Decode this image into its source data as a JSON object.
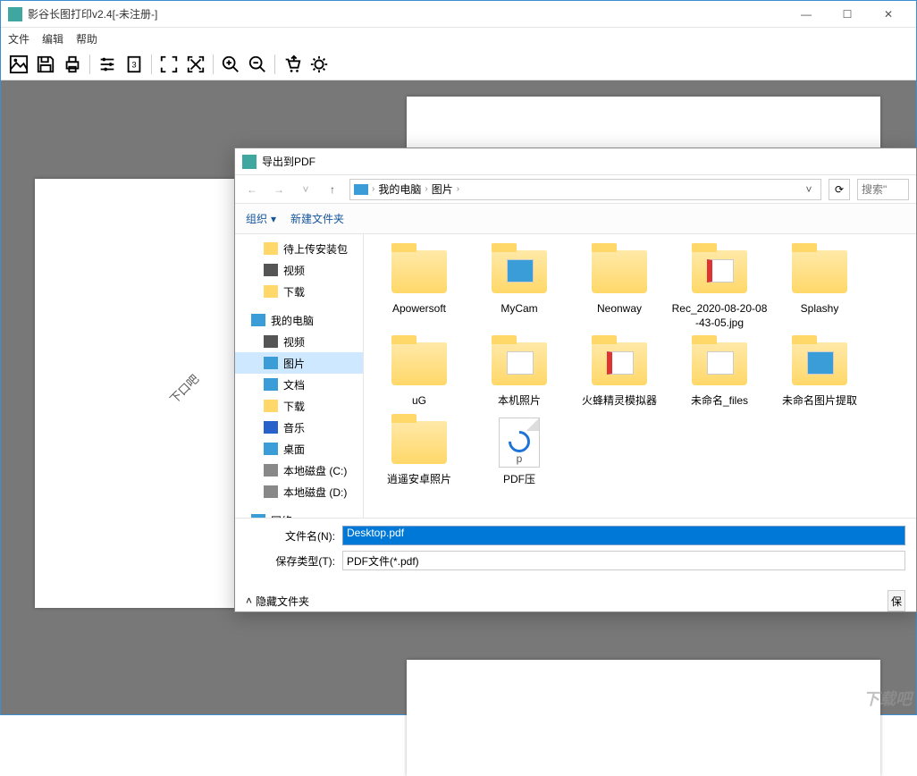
{
  "app": {
    "title": "影谷长图打印v2.4[-未注册-]",
    "menu": {
      "file": "文件",
      "edit": "编辑",
      "help": "帮助"
    },
    "rotated_hint": "下口吧"
  },
  "dialog": {
    "title": "导出到PDF",
    "breadcrumb": {
      "root": "我的电脑",
      "folder": "图片"
    },
    "search_placeholder": "搜索\"",
    "toolbar": {
      "organize": "组织",
      "new_folder": "新建文件夹"
    },
    "tree": [
      {
        "label": "待上传安装包",
        "icon": "ico-folder",
        "level": "l2"
      },
      {
        "label": "视频",
        "icon": "ico-video",
        "level": "l2"
      },
      {
        "label": "下载",
        "icon": "ico-download",
        "level": "l2"
      },
      {
        "label": "",
        "icon": "",
        "level": "spacer"
      },
      {
        "label": "我的电脑",
        "icon": "ico-computer",
        "level": ""
      },
      {
        "label": "视频",
        "icon": "ico-video",
        "level": "l2"
      },
      {
        "label": "图片",
        "icon": "ico-pictures",
        "level": "l2",
        "selected": true
      },
      {
        "label": "文档",
        "icon": "ico-doc",
        "level": "l2"
      },
      {
        "label": "下载",
        "icon": "ico-download",
        "level": "l2"
      },
      {
        "label": "音乐",
        "icon": "ico-music",
        "level": "l2"
      },
      {
        "label": "桌面",
        "icon": "ico-desktop",
        "level": "l2"
      },
      {
        "label": "本地磁盘 (C:)",
        "icon": "ico-disk",
        "level": "l2"
      },
      {
        "label": "本地磁盘 (D:)",
        "icon": "ico-disk",
        "level": "l2"
      },
      {
        "label": "",
        "icon": "",
        "level": "spacer"
      },
      {
        "label": "网络",
        "icon": "ico-network",
        "level": ""
      }
    ],
    "files": [
      {
        "name": "Apowersoft",
        "type": "folder"
      },
      {
        "name": "MyCam",
        "type": "folder-blue"
      },
      {
        "name": "Neonway",
        "type": "folder"
      },
      {
        "name": "Rec_2020-08-20-08-43-05.jpg",
        "type": "folder-red"
      },
      {
        "name": "Splashy",
        "type": "folder"
      },
      {
        "name": "uG",
        "type": "folder"
      },
      {
        "name": "本机照片",
        "type": "folder-page"
      },
      {
        "name": "火蜂精灵模拟器",
        "type": "folder-red"
      },
      {
        "name": "未命名_files",
        "type": "folder-page"
      },
      {
        "name": "未命名图片提取",
        "type": "folder-blue"
      },
      {
        "name": "逍遥安卓照片",
        "type": "folder"
      },
      {
        "name": "PDF压",
        "type": "file-pdf"
      }
    ],
    "filename_label": "文件名(N):",
    "filename_value": "Desktop.pdf",
    "filetype_label": "保存类型(T):",
    "filetype_value": "PDF文件(*.pdf)",
    "hide_folders": "隐藏文件夹",
    "save": "保"
  },
  "watermark": "下载吧"
}
